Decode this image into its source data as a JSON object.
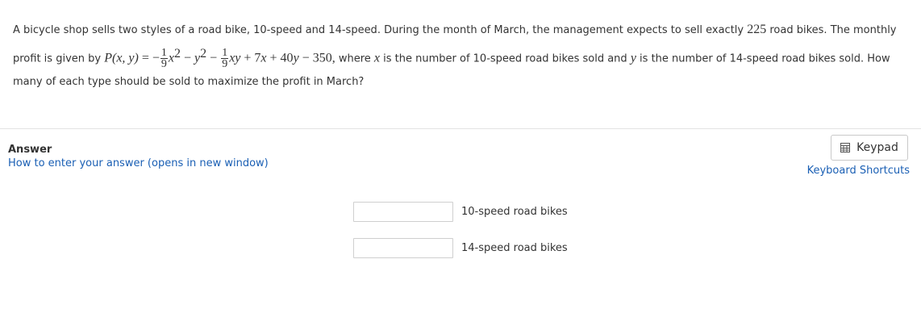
{
  "question": {
    "part1": "A bicycle shop sells two styles of a road bike, 10-speed and 14-speed.  During the month of March, the management expects to sell exactly ",
    "total": "225",
    "part2": " road bikes.  The monthly profit is given by ",
    "function": "P(x, y)",
    "eq_sign": " = −",
    "frac1_num": "1",
    "frac1_den": "9",
    "term1": "x",
    "exp1": "2",
    "minus1": " − ",
    "term2": "y",
    "exp2": "2",
    "minus2": " − ",
    "frac2_num": "1",
    "frac2_den": "9",
    "term3": "xy",
    "plus1": " + 7",
    "term4": "x",
    "plus2": " + 40",
    "term5": "y",
    "tail": " − 350,",
    "part3": "  where ",
    "var_x": "x",
    "part4": " is the number of 10-speed road bikes sold and ",
    "var_y": "y",
    "part5": " is the number of 14-speed road bikes sold.  How many of each type should be sold to maximize the profit in March?"
  },
  "answer": {
    "label": "Answer",
    "howto_link": "How to enter your answer (opens in new window)",
    "keypad_button": "Keypad",
    "keyboard_shortcuts": "Keyboard Shortcuts",
    "fields": [
      {
        "value": "",
        "label": "10-speed road bikes"
      },
      {
        "value": "",
        "label": "14-speed road bikes"
      }
    ]
  },
  "icons": {
    "keypad": "keypad-icon"
  }
}
